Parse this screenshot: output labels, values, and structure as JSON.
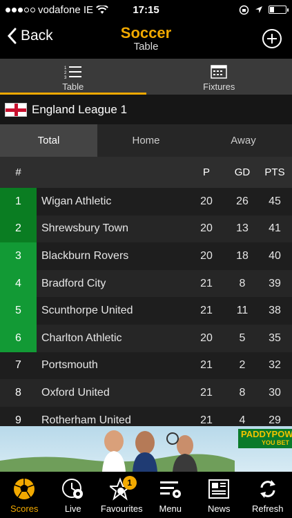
{
  "status": {
    "carrier": "vodafone IE",
    "time": "17:15"
  },
  "nav": {
    "back_label": "Back",
    "title": "Soccer",
    "subtitle": "Table"
  },
  "top_tabs": [
    {
      "label": "Table"
    },
    {
      "label": "Fixtures"
    }
  ],
  "league": {
    "name": "England League 1"
  },
  "segments": [
    {
      "label": "Total"
    },
    {
      "label": "Home"
    },
    {
      "label": "Away"
    }
  ],
  "table": {
    "headers": {
      "pos": "#",
      "p": "P",
      "gd": "GD",
      "pts": "PTS"
    },
    "rows": [
      {
        "pos": "1",
        "team": "Wigan Athletic",
        "p": "20",
        "gd": "26",
        "pts": "45"
      },
      {
        "pos": "2",
        "team": "Shrewsbury Town",
        "p": "20",
        "gd": "13",
        "pts": "41"
      },
      {
        "pos": "3",
        "team": "Blackburn Rovers",
        "p": "20",
        "gd": "18",
        "pts": "40"
      },
      {
        "pos": "4",
        "team": "Bradford City",
        "p": "21",
        "gd": "8",
        "pts": "39"
      },
      {
        "pos": "5",
        "team": "Scunthorpe United",
        "p": "21",
        "gd": "11",
        "pts": "38"
      },
      {
        "pos": "6",
        "team": "Charlton Athletic",
        "p": "20",
        "gd": "5",
        "pts": "35"
      },
      {
        "pos": "7",
        "team": "Portsmouth",
        "p": "21",
        "gd": "2",
        "pts": "32"
      },
      {
        "pos": "8",
        "team": "Oxford United",
        "p": "21",
        "gd": "8",
        "pts": "30"
      },
      {
        "pos": "9",
        "team": "Rotherham United",
        "p": "21",
        "gd": "4",
        "pts": "29"
      }
    ]
  },
  "ad": {
    "brand": "PADDYPOWER",
    "tagline": "YOU BET"
  },
  "tab_bar": [
    {
      "label": "Scores"
    },
    {
      "label": "Live"
    },
    {
      "label": "Favourites",
      "badge": "1"
    },
    {
      "label": "Menu"
    },
    {
      "label": "News"
    },
    {
      "label": "Refresh"
    }
  ],
  "colors": {
    "accent": "#f2a900",
    "promo_green": "#129a35",
    "top_green": "#0a7d22"
  }
}
